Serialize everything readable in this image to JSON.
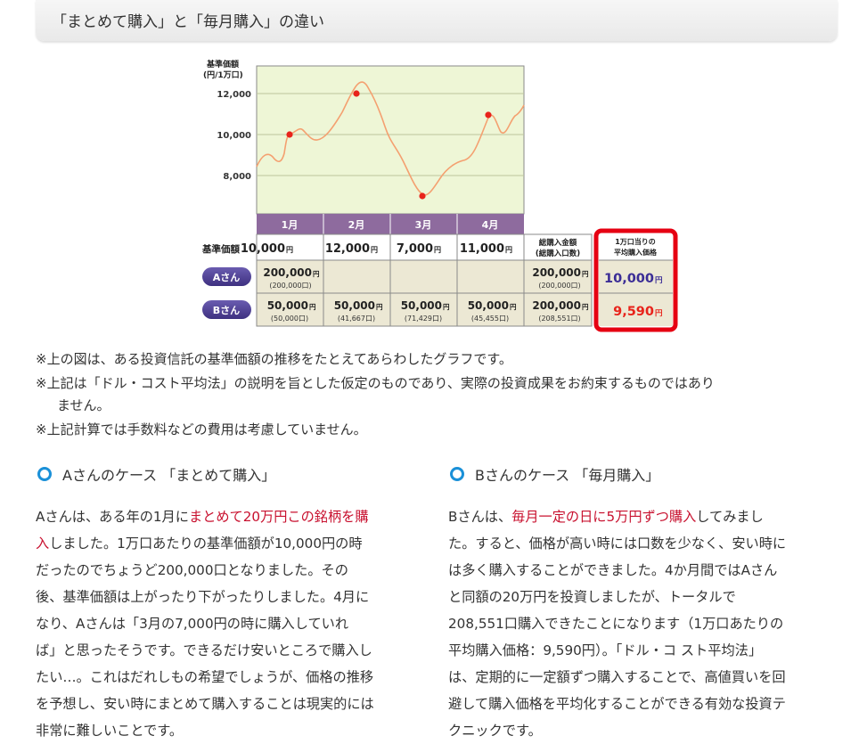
{
  "header": {
    "title": "「まとめて購入」と「毎月購入」の違い"
  },
  "chart_data": {
    "type": "line",
    "ylabel_line1": "基準価額",
    "ylabel_line2": "(円/1万口)",
    "y_ticks": [
      "12,000",
      "10,000",
      "8,000"
    ],
    "categories": [
      "1月",
      "2月",
      "3月",
      "4月"
    ],
    "purchase_points": [
      10000,
      12000,
      7000,
      11000
    ]
  },
  "table": {
    "row_label_price": "基準価額",
    "prices": [
      {
        "num": "10,000",
        "unit": "円"
      },
      {
        "num": "12,000",
        "unit": "円"
      },
      {
        "num": "7,000",
        "unit": "円"
      },
      {
        "num": "11,000",
        "unit": "円"
      }
    ],
    "total_header_line1": "総購入金額",
    "total_header_line2": "(総購入口数)",
    "avg_header_line1": "1万口当りの",
    "avg_header_line2": "平均購入価格",
    "a_label": "Aさん",
    "b_label": "Bさん",
    "a_cells": [
      {
        "num": "200,000",
        "unit": "円",
        "sub": "(200,000口)"
      }
    ],
    "a_total": {
      "num": "200,000",
      "unit": "円",
      "sub": "(200,000口)"
    },
    "a_avg": {
      "num": "10,000",
      "unit": "円"
    },
    "b_cells": [
      {
        "num": "50,000",
        "unit": "円",
        "sub": "(50,000口)"
      },
      {
        "num": "50,000",
        "unit": "円",
        "sub": "(41,667口)"
      },
      {
        "num": "50,000",
        "unit": "円",
        "sub": "(71,429口)"
      },
      {
        "num": "50,000",
        "unit": "円",
        "sub": "(45,455口)"
      }
    ],
    "b_total": {
      "num": "200,000",
      "unit": "円",
      "sub": "(208,551口)"
    },
    "b_avg": {
      "num": "9,590",
      "unit": "円"
    }
  },
  "notes": [
    "※上の図は、ある投資信託の基準価額の推移をたとえてあらわしたグラフです。",
    "※上記は「ドル・コスト平均法」の説明を旨とした仮定のものであり、実際の投資成果をお約束するものではあり",
    "ません。",
    "※上記計算では手数料などの費用は考慮していません。"
  ],
  "case_a": {
    "heading": "Aさんのケース 「まとめて購入」",
    "lines": [
      {
        "pre": "Aさんは、ある年の1月に",
        "hl": "まとめて20万円この銘柄を購",
        "post": ""
      },
      {
        "pre": "",
        "hl": "入",
        "post": "しました。1万口あたりの基準価額が10,000円の時"
      },
      {
        "pre": "だったのでちょうど200,000口となりました。その",
        "hl": "",
        "post": ""
      },
      {
        "pre": "後、基準価額は上がったり下がったりしました。4月に",
        "hl": "",
        "post": ""
      },
      {
        "pre": "なり、Aさんは「3月の7,000円の時に購入していれ",
        "hl": "",
        "post": ""
      },
      {
        "pre": "ば」と思ったそうです。できるだけ安いところで購入し",
        "hl": "",
        "post": ""
      },
      {
        "pre": "たい…。これはだれしもの希望でしょうが、価格の推移",
        "hl": "",
        "post": ""
      },
      {
        "pre": "を予想し、安い時にまとめて購入することは現実的には",
        "hl": "",
        "post": ""
      },
      {
        "pre": "非常に難しいことです。",
        "hl": "",
        "post": ""
      }
    ]
  },
  "case_b": {
    "heading": "Bさんのケース 「毎月購入」",
    "lines": [
      {
        "pre": "Bさんは、",
        "hl": "毎月一定の日に5万円ずつ購入",
        "post": "してみまし"
      },
      {
        "pre": "た。すると、価格が高い時には口数を少なく、安い時に",
        "hl": "",
        "post": ""
      },
      {
        "pre": "は多く購入することができました。4か月間ではAさん",
        "hl": "",
        "post": ""
      },
      {
        "pre": "と同額の20万円を投資しましたが、トータルで",
        "hl": "",
        "post": ""
      },
      {
        "pre": "208,551口購入できたことになります（1万口あたりの",
        "hl": "",
        "post": ""
      },
      {
        "pre": "平均購入価格：9,590円）。「ドル・コ スト平均法」",
        "hl": "",
        "post": ""
      },
      {
        "pre": "は、定期的に一定額ずつ購入することで、高値買いを回",
        "hl": "",
        "post": ""
      },
      {
        "pre": "避して購入価格を平均化することができる有効な投資テ",
        "hl": "",
        "post": ""
      },
      {
        "pre": "クニックです。",
        "hl": "",
        "post": ""
      }
    ]
  },
  "colors": {
    "plot_bg": "#eef6d6",
    "month_bar": "#8e6b9e",
    "line": "#f4a070",
    "dot": "#e8231b",
    "row_bg": "#ece8d4",
    "badge": "#4a3c8c",
    "highlight_frame": "#e60012",
    "avg_a_text": "#3b2d96",
    "avg_b_text": "#e8231b",
    "bullet": "#1a90d8",
    "emphasis": "#c8102e"
  }
}
